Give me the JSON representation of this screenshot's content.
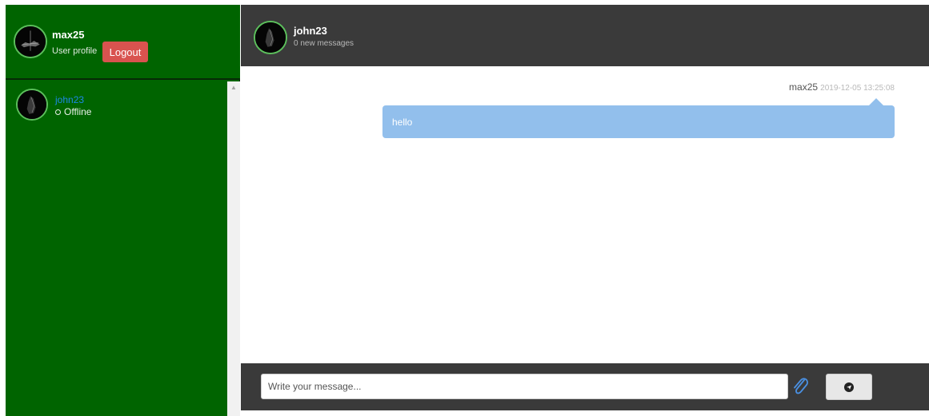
{
  "profile": {
    "username": "max25",
    "subtitle": "User profile",
    "logout_label": "Logout",
    "avatar_icon": "avatar-icon"
  },
  "contacts": [
    {
      "name": "john23",
      "status": "Offline",
      "avatar_icon": "avatar-icon"
    }
  ],
  "chat": {
    "header_name": "john23",
    "header_sub": "0 new messages",
    "messages": [
      {
        "author": "max25",
        "timestamp": "2019-12-05 13:25:08",
        "text": "hello"
      }
    ]
  },
  "composer": {
    "placeholder": "Write your message...",
    "attach_icon": "paperclip-icon",
    "send_icon": "send-icon"
  },
  "colors": {
    "sidebar": "#006400",
    "header": "#3a3a3a",
    "logout": "#d9534f",
    "bubble": "#92bfec",
    "contact_name": "#1e88e5"
  }
}
